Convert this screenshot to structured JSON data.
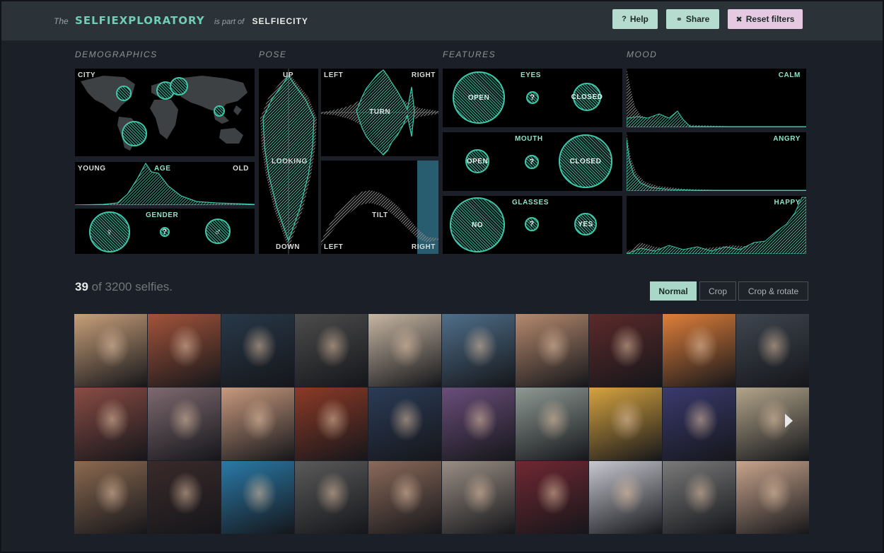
{
  "header": {
    "prefix": "The",
    "title": "SELFIEXPLORATORY",
    "connector": "is part of",
    "parent": "SELFIECITY",
    "buttons": {
      "help": {
        "icon": "?",
        "label": "Help"
      },
      "share": {
        "icon": "⚭",
        "label": "Share"
      },
      "reset": {
        "icon": "✖",
        "label": "Reset filters"
      }
    }
  },
  "sections": {
    "demographics": "DEMOGRAPHICS",
    "pose": "POSE",
    "features": "FEATURES",
    "mood": "MOOD"
  },
  "demographics": {
    "city": "CITY",
    "age": {
      "left": "YOUNG",
      "center": "AGE",
      "right": "OLD"
    },
    "gender": {
      "title": "GENDER",
      "female": "♀",
      "unknown": "?",
      "male": "♂"
    }
  },
  "pose": {
    "looking": {
      "top": "UP",
      "center": "LOOKING",
      "bottom": "DOWN"
    },
    "turn": {
      "left": "LEFT",
      "center": "TURN",
      "right": "RIGHT"
    },
    "tilt": {
      "left": "LEFT",
      "center": "TILT",
      "right": "RIGHT"
    }
  },
  "features": {
    "eyes": {
      "title": "EYES",
      "open": "OPEN",
      "unknown": "?",
      "closed": "CLOSED"
    },
    "mouth": {
      "title": "MOUTH",
      "open": "OPEN",
      "unknown": "?",
      "closed": "CLOSED"
    },
    "glasses": {
      "title": "GLASSES",
      "no": "NO",
      "unknown": "?",
      "yes": "YES"
    }
  },
  "mood": {
    "calm": "CALM",
    "angry": "ANGRY",
    "happy": "HAPPY"
  },
  "results": {
    "count": "39",
    "of_text": "of 3200 selfies."
  },
  "view_modes": {
    "normal": "Normal",
    "crop": "Crop",
    "crop_rotate": "Crop & rotate",
    "selected": "Normal"
  },
  "colors": {
    "accent": "#3cc8a9",
    "header_bg": "#2b3338",
    "page_bg": "#1b1f27",
    "panel_bg": "#000000",
    "help_btn": "#b5dccf",
    "reset_btn": "#e5c8e2"
  },
  "photo_tones": [
    [
      "#c9a07a",
      "#a3543a",
      "#283848",
      "#4c4c4c",
      "#c7b6a3",
      "#4f6f8a",
      "#b68a6e",
      "#5c2a2a",
      "#e07f3a",
      "#3f4650"
    ],
    [
      "#8a4c44",
      "#7e6a70",
      "#c99a7e",
      "#8c3a26",
      "#2b3b56",
      "#6a4e7a",
      "#8f9a94",
      "#d7a440",
      "#3a3a6e",
      "#b3a58a"
    ],
    [
      "#8c6a50",
      "#3a2a2a",
      "#2a7aa8",
      "#5a5a5a",
      "#8b6a5a",
      "#9a8e84",
      "#702832",
      "#c8c8d0",
      "#7a7a7a",
      "#c9a58c"
    ]
  ]
}
